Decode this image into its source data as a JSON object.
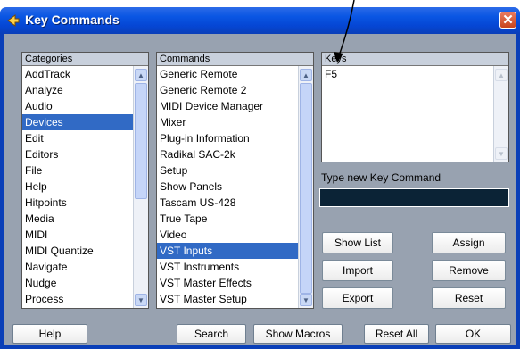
{
  "window": {
    "title": "Key Commands",
    "close_glyph": "✕"
  },
  "categories": {
    "header": "Categories",
    "items": [
      "AddTrack",
      "Analyze",
      "Audio",
      "Devices",
      "Edit",
      "Editors",
      "File",
      "Help",
      "Hitpoints",
      "Media",
      "MIDI",
      "MIDI Quantize",
      "Navigate",
      "Nudge",
      "Process"
    ],
    "selected": "Devices"
  },
  "commands": {
    "header": "Commands",
    "items": [
      "Generic Remote",
      "Generic Remote 2",
      "MIDI Device Manager",
      "Mixer",
      "Plug-in Information",
      "Radikal SAC-2k",
      "Setup",
      "Show Panels",
      "Tascam US-428",
      "True Tape",
      "Video",
      "VST Inputs",
      "VST Instruments",
      "VST Master Effects",
      "VST Master Setup"
    ],
    "selected": "VST Inputs"
  },
  "keys": {
    "header": "Keys",
    "items": [
      "F5"
    ]
  },
  "new_key": {
    "label": "Type new Key Command",
    "value": ""
  },
  "buttons": {
    "show_list": "Show List",
    "assign": "Assign",
    "import": "Import",
    "remove": "Remove",
    "export": "Export",
    "reset": "Reset"
  },
  "bottom": {
    "help": "Help",
    "search": "Search",
    "show_macros": "Show Macros",
    "reset_all": "Reset All",
    "ok": "OK"
  },
  "colors": {
    "title_bar": "#0a56e3",
    "selection": "#316ac5",
    "dialog_bg": "#98a2b0",
    "key_input_bg": "#0b2336"
  }
}
